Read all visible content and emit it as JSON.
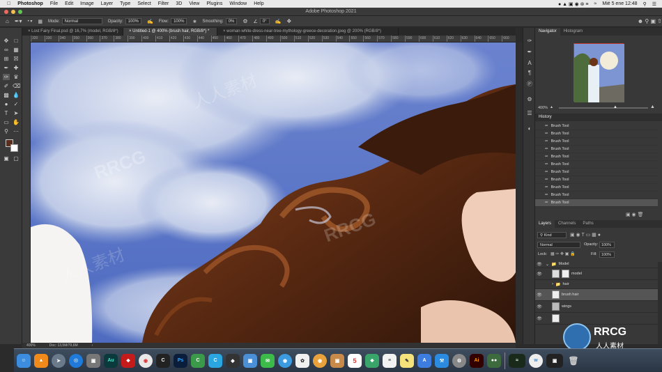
{
  "menubar": {
    "app_name": "Photoshop",
    "items": [
      "File",
      "Edit",
      "Image",
      "Layer",
      "Type",
      "Select",
      "Filter",
      "3D",
      "View",
      "Plugins",
      "Window",
      "Help"
    ],
    "clock": "Mié 5 ene  12:48"
  },
  "window": {
    "title": "Adobe Photoshop 2021"
  },
  "options": {
    "mode_label": "Mode:",
    "mode_value": "Normal",
    "opacity_label": "Opacity:",
    "opacity_value": "100%",
    "flow_label": "Flow:",
    "flow_value": "100%",
    "smoothing_label": "Smoothing:",
    "smoothing_value": "0%",
    "angle_value": "0°"
  },
  "tabs": [
    {
      "label": "Lost Fairy Final.psd @ 16,7% (model, RGB/8*)"
    },
    {
      "label": "Untitled-1 @ 400% (brush hair, RGB/8*) *"
    },
    {
      "label": "woman-white-dress-near-tree-mythology-greece-decoration.jpeg @ 200% (RGB/8*)"
    }
  ],
  "ruler_ticks": [
    "320",
    "330",
    "340",
    "350",
    "360",
    "370",
    "380",
    "390",
    "400",
    "410",
    "420",
    "430",
    "440",
    "450",
    "460",
    "470",
    "480",
    "490",
    "500",
    "510",
    "520",
    "530",
    "540",
    "550",
    "560",
    "570",
    "580",
    "590",
    "600",
    "610",
    "620",
    "630",
    "640",
    "650",
    "660"
  ],
  "statusbar": {
    "zoom": "400%",
    "doc": "Doc: 13,5M/79,6M"
  },
  "navigator": {
    "tabs": [
      "Navigator",
      "Histogram"
    ],
    "zoom": "400%"
  },
  "history": {
    "title": "History",
    "items": [
      "Brush Tool",
      "Brush Tool",
      "Brush Tool",
      "Brush Tool",
      "Brush Tool",
      "Brush Tool",
      "Brush Tool",
      "Brush Tool",
      "Brush Tool",
      "Brush Tool",
      "Brush Tool"
    ]
  },
  "layers": {
    "tabs": [
      "Layers",
      "Channels",
      "Paths"
    ],
    "kind": "Kind",
    "blend": "Normal",
    "opacity_label": "Opacity:",
    "opacity_value": "100%",
    "lock_label": "Lock:",
    "fill_label": "Fill:",
    "fill_value": "100%",
    "rows": [
      {
        "name": "Model"
      },
      {
        "name": "model"
      },
      {
        "name": "hair"
      },
      {
        "name": "brush hair"
      },
      {
        "name": "wings"
      }
    ]
  },
  "dock": {
    "apps": [
      "Au",
      "Ps",
      "Ai"
    ],
    "calendar_day": "5"
  },
  "watermark": {
    "brand": "RRCG",
    "sub": "人人素材"
  },
  "colors": {
    "accent": "#2f6fb0",
    "sky": "#5a76c6",
    "hair": "#6b3418"
  }
}
